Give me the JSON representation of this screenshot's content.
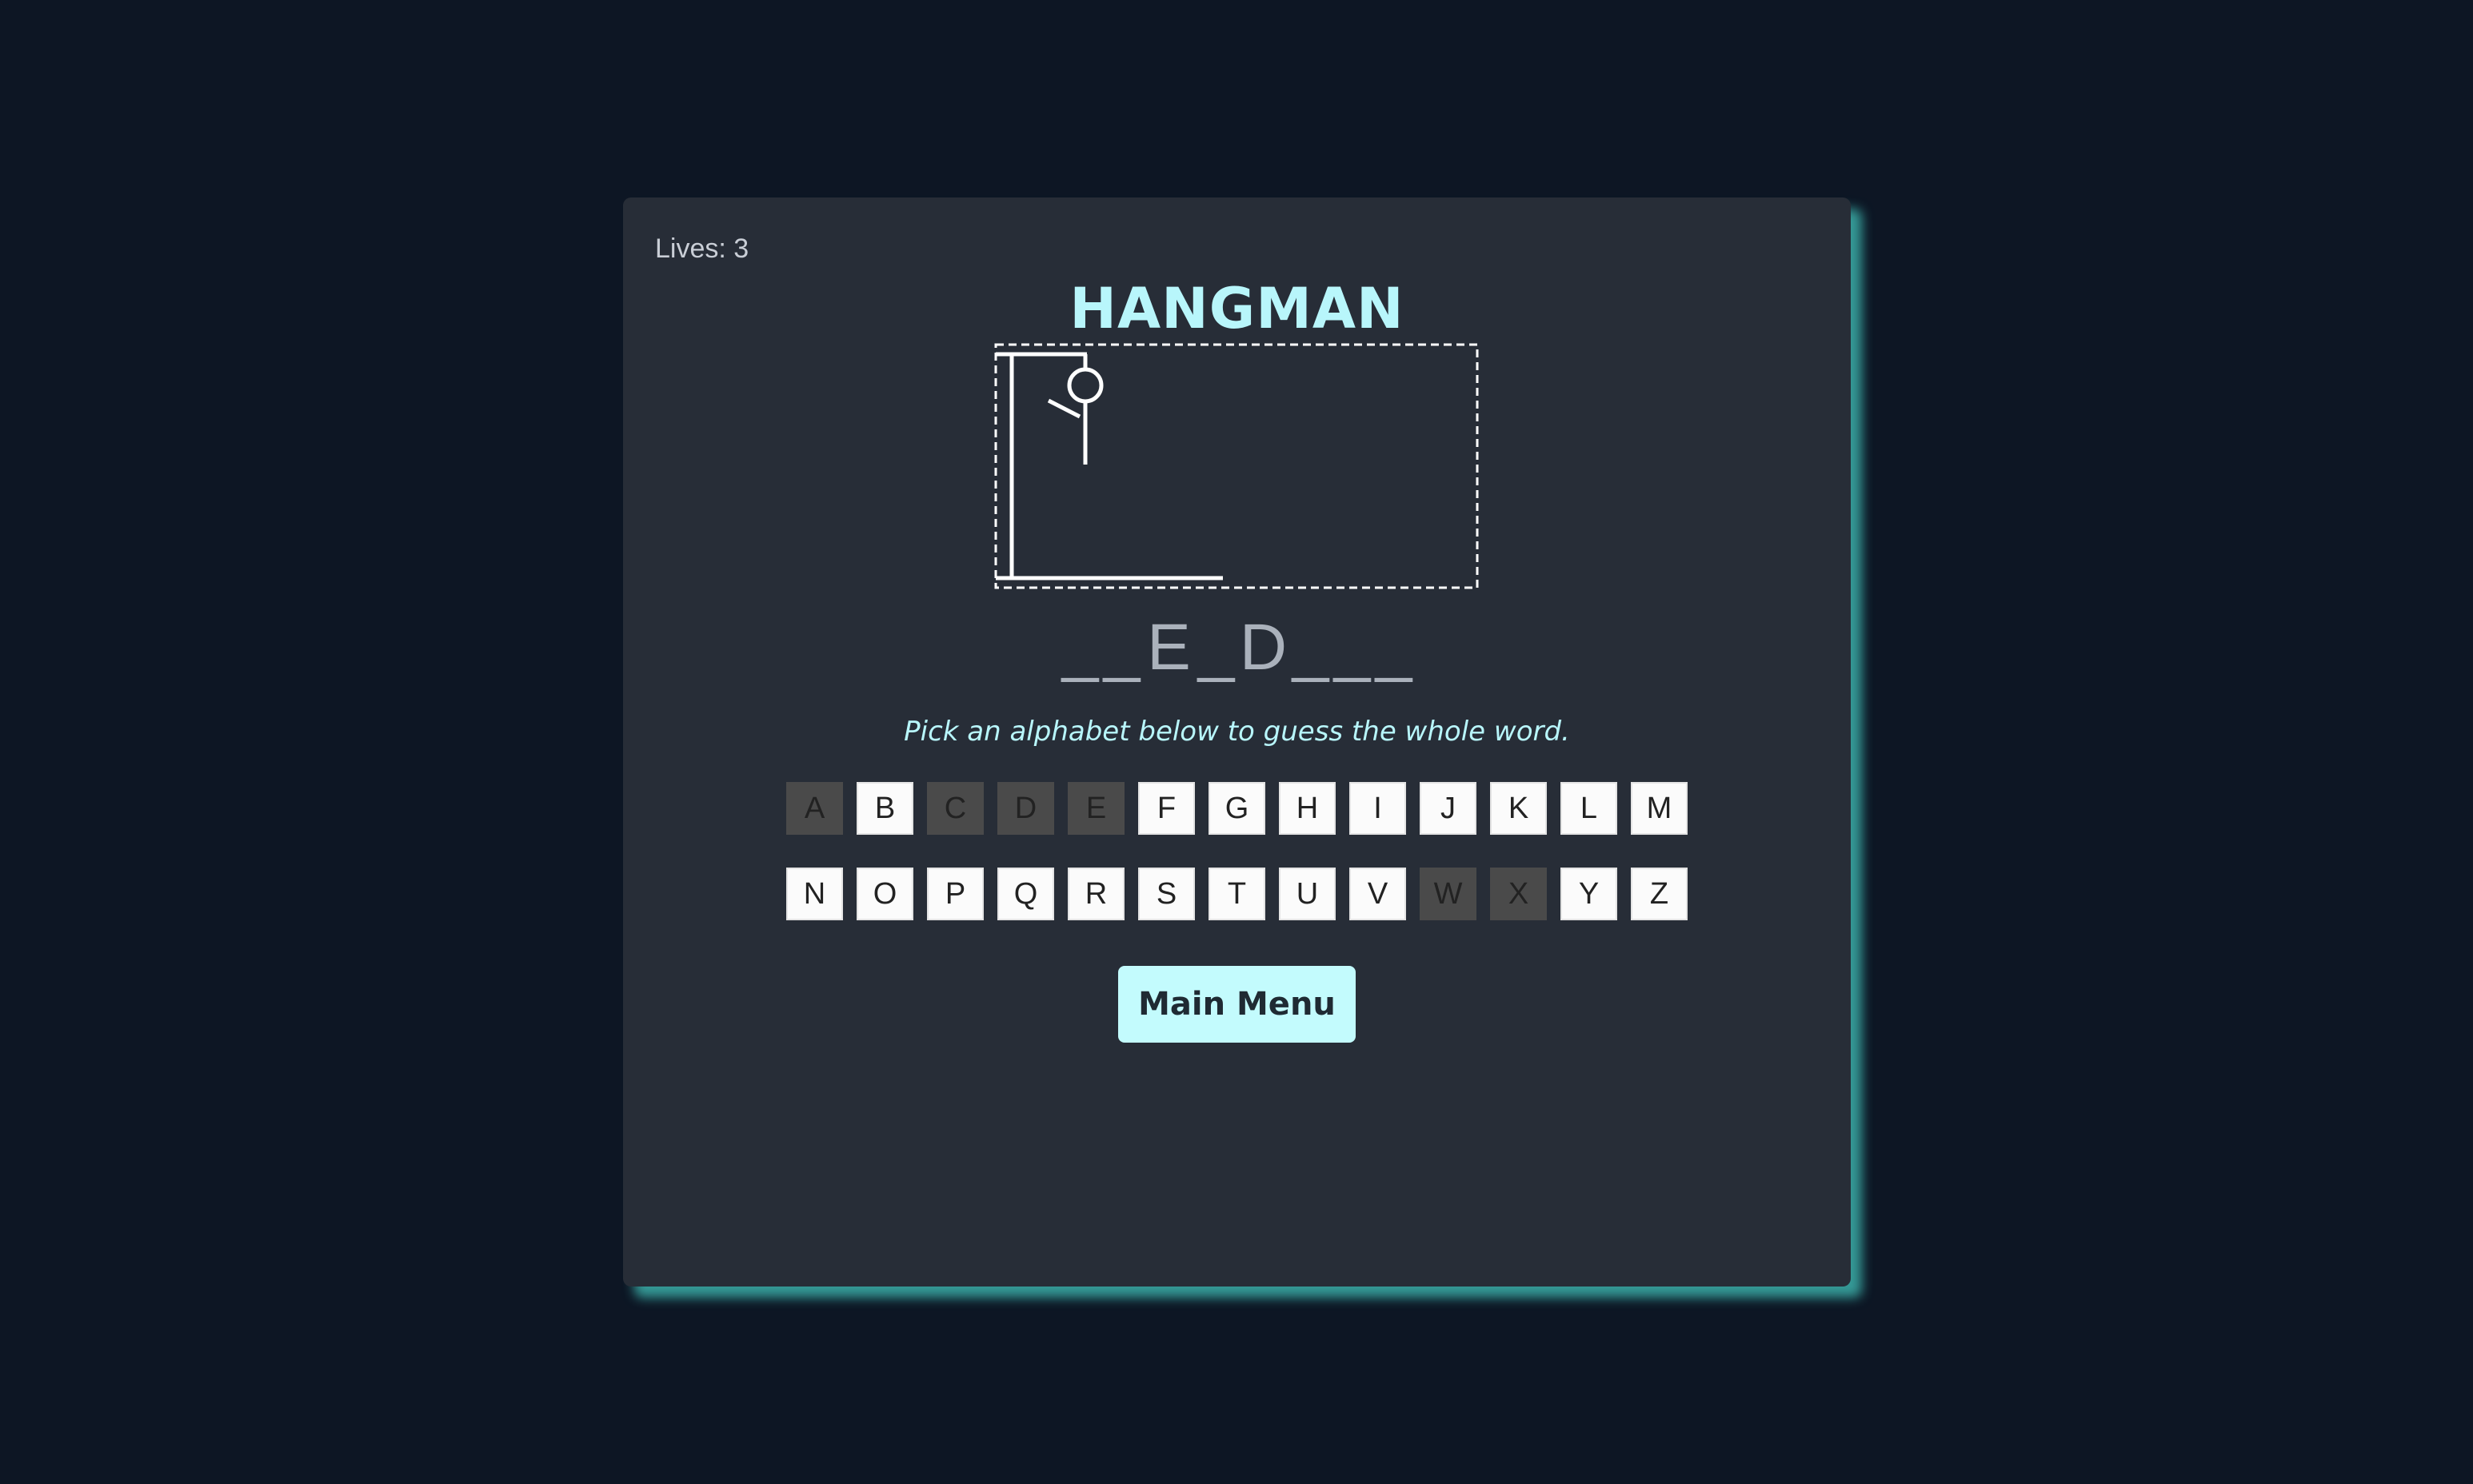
{
  "game": {
    "lives_label": "Lives: 3",
    "title": "HANGMAN",
    "hint": "Pick an alphabet below to guess the whole word.",
    "word_slots": [
      "_",
      "_",
      "E",
      "_",
      "D",
      "_",
      "_",
      "_"
    ],
    "keyboard": {
      "row1": [
        {
          "letter": "A",
          "used": true
        },
        {
          "letter": "B",
          "used": false
        },
        {
          "letter": "C",
          "used": true
        },
        {
          "letter": "D",
          "used": true
        },
        {
          "letter": "E",
          "used": true
        },
        {
          "letter": "F",
          "used": false
        },
        {
          "letter": "G",
          "used": false
        },
        {
          "letter": "H",
          "used": false
        },
        {
          "letter": "I",
          "used": false
        },
        {
          "letter": "J",
          "used": false
        },
        {
          "letter": "K",
          "used": false
        },
        {
          "letter": "L",
          "used": false
        },
        {
          "letter": "M",
          "used": false
        }
      ],
      "row2": [
        {
          "letter": "N",
          "used": false
        },
        {
          "letter": "O",
          "used": false
        },
        {
          "letter": "P",
          "used": false
        },
        {
          "letter": "Q",
          "used": false
        },
        {
          "letter": "R",
          "used": false
        },
        {
          "letter": "S",
          "used": false
        },
        {
          "letter": "T",
          "used": false
        },
        {
          "letter": "U",
          "used": false
        },
        {
          "letter": "V",
          "used": false
        },
        {
          "letter": "W",
          "used": true
        },
        {
          "letter": "X",
          "used": true
        },
        {
          "letter": "Y",
          "used": false
        },
        {
          "letter": "Z",
          "used": false
        }
      ]
    },
    "main_menu_label": "Main Menu",
    "hangman_parts_drawn": [
      "head",
      "body",
      "left-arm"
    ]
  },
  "colors": {
    "background": "#0d1624",
    "card": "#272d37",
    "accent": "#b8f6fb",
    "button": "#c3fbfd",
    "shadow": "#3cb0aa",
    "used_key": "#4a4a4a"
  }
}
